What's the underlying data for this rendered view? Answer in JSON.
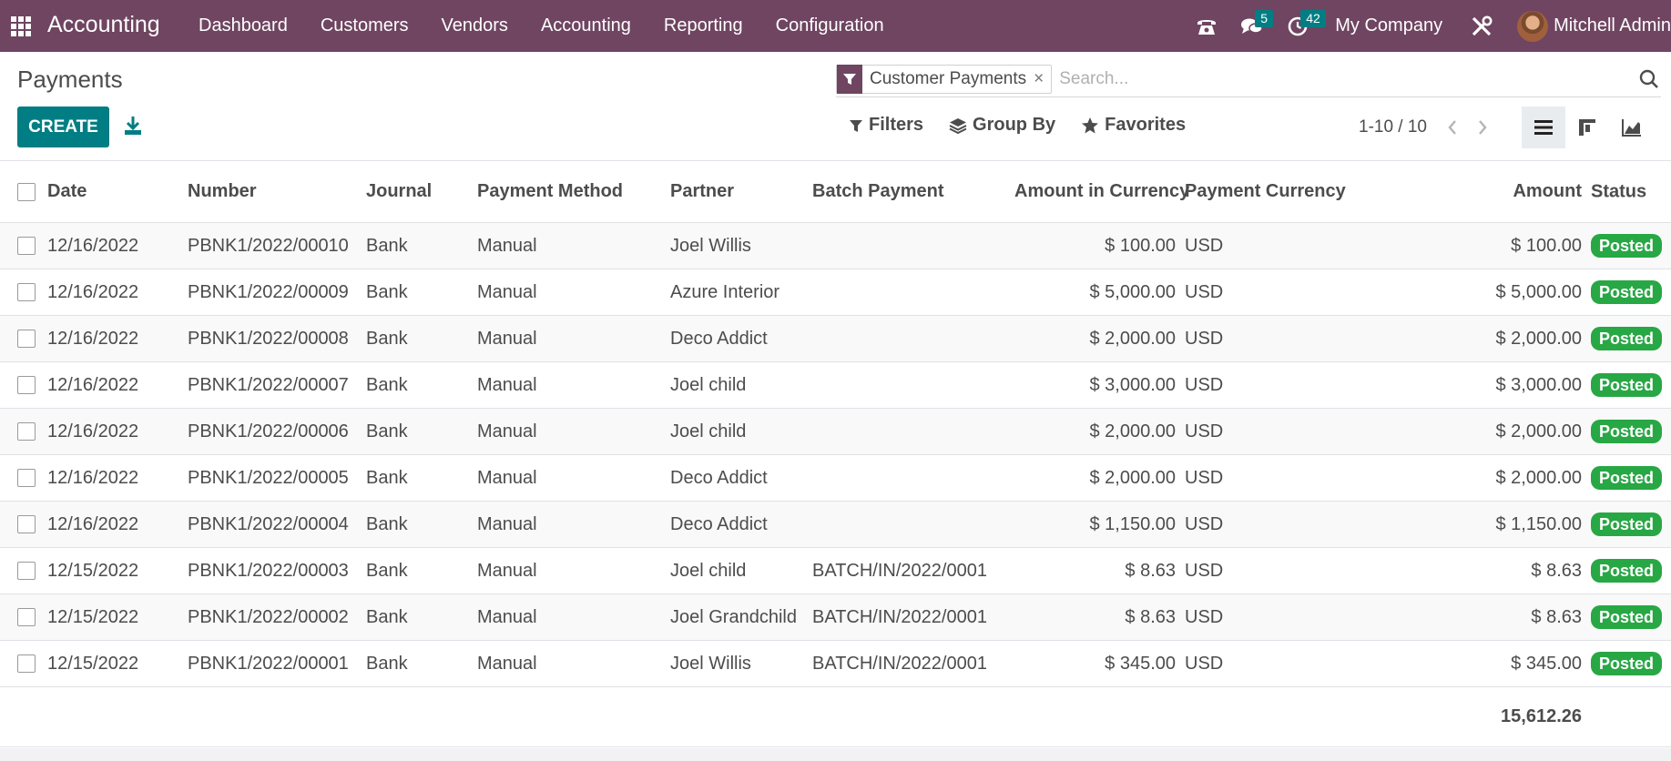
{
  "nav": {
    "brand": "Accounting",
    "menu": [
      "Dashboard",
      "Customers",
      "Vendors",
      "Accounting",
      "Reporting",
      "Configuration"
    ],
    "messages_count": "5",
    "activities_count": "42",
    "company": "My Company",
    "user": "Mitchell Admin"
  },
  "control": {
    "title": "Payments",
    "create_label": "CREATE",
    "facet_label": "Customer Payments",
    "facet_close": "×",
    "search_placeholder": "Search...",
    "filters_label": "Filters",
    "groupby_label": "Group By",
    "favorites_label": "Favorites",
    "pager": "1-10 / 10"
  },
  "table": {
    "headers": {
      "date": "Date",
      "number": "Number",
      "journal": "Journal",
      "method": "Payment Method",
      "partner": "Partner",
      "batch": "Batch Payment",
      "amount_currency": "Amount in Currency",
      "currency": "Payment Currency",
      "amount": "Amount",
      "status": "Status"
    },
    "rows": [
      {
        "date": "12/16/2022",
        "number": "PBNK1/2022/00010",
        "journal": "Bank",
        "method": "Manual",
        "partner": "Joel Willis",
        "batch": "",
        "amount_currency": "$ 100.00",
        "currency": "USD",
        "amount": "$ 100.00",
        "status": "Posted"
      },
      {
        "date": "12/16/2022",
        "number": "PBNK1/2022/00009",
        "journal": "Bank",
        "method": "Manual",
        "partner": "Azure Interior",
        "batch": "",
        "amount_currency": "$ 5,000.00",
        "currency": "USD",
        "amount": "$ 5,000.00",
        "status": "Posted"
      },
      {
        "date": "12/16/2022",
        "number": "PBNK1/2022/00008",
        "journal": "Bank",
        "method": "Manual",
        "partner": "Deco Addict",
        "batch": "",
        "amount_currency": "$ 2,000.00",
        "currency": "USD",
        "amount": "$ 2,000.00",
        "status": "Posted"
      },
      {
        "date": "12/16/2022",
        "number": "PBNK1/2022/00007",
        "journal": "Bank",
        "method": "Manual",
        "partner": "Joel child",
        "batch": "",
        "amount_currency": "$ 3,000.00",
        "currency": "USD",
        "amount": "$ 3,000.00",
        "status": "Posted"
      },
      {
        "date": "12/16/2022",
        "number": "PBNK1/2022/00006",
        "journal": "Bank",
        "method": "Manual",
        "partner": "Joel child",
        "batch": "",
        "amount_currency": "$ 2,000.00",
        "currency": "USD",
        "amount": "$ 2,000.00",
        "status": "Posted"
      },
      {
        "date": "12/16/2022",
        "number": "PBNK1/2022/00005",
        "journal": "Bank",
        "method": "Manual",
        "partner": "Deco Addict",
        "batch": "",
        "amount_currency": "$ 2,000.00",
        "currency": "USD",
        "amount": "$ 2,000.00",
        "status": "Posted"
      },
      {
        "date": "12/16/2022",
        "number": "PBNK1/2022/00004",
        "journal": "Bank",
        "method": "Manual",
        "partner": "Deco Addict",
        "batch": "",
        "amount_currency": "$ 1,150.00",
        "currency": "USD",
        "amount": "$ 1,150.00",
        "status": "Posted"
      },
      {
        "date": "12/15/2022",
        "number": "PBNK1/2022/00003",
        "journal": "Bank",
        "method": "Manual",
        "partner": "Joel child",
        "batch": "BATCH/IN/2022/0001",
        "amount_currency": "$ 8.63",
        "currency": "USD",
        "amount": "$ 8.63",
        "status": "Posted"
      },
      {
        "date": "12/15/2022",
        "number": "PBNK1/2022/00002",
        "journal": "Bank",
        "method": "Manual",
        "partner": "Joel Grandchild",
        "batch": "BATCH/IN/2022/0001",
        "amount_currency": "$ 8.63",
        "currency": "USD",
        "amount": "$ 8.63",
        "status": "Posted"
      },
      {
        "date": "12/15/2022",
        "number": "PBNK1/2022/00001",
        "journal": "Bank",
        "method": "Manual",
        "partner": "Joel Willis",
        "batch": "BATCH/IN/2022/0001",
        "amount_currency": "$ 345.00",
        "currency": "USD",
        "amount": "$ 345.00",
        "status": "Posted"
      }
    ],
    "total": "15,612.26"
  },
  "colors": {
    "navbar": "#6f4561",
    "primary": "#017e84",
    "posted": "#28a745"
  },
  "icons": {
    "apps": "apps-grid-icon",
    "phone": "phone-icon",
    "messages": "chat-icon",
    "activities": "clock-icon",
    "debug": "tools-icon",
    "download": "download-icon",
    "facet": "filter-icon",
    "search": "search-icon",
    "groupby": "layers-icon",
    "favorites": "star-icon",
    "list_view": "list-view-icon",
    "kanban_view": "kanban-view-icon",
    "graph_view": "graph-view-icon",
    "optional_columns": "sliders-icon"
  }
}
